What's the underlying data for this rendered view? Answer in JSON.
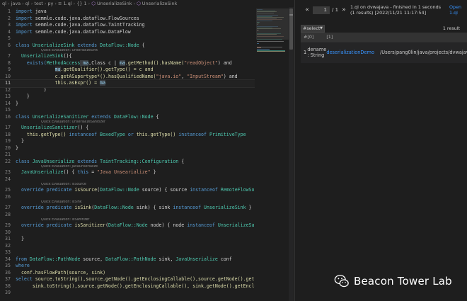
{
  "breadcrumb": {
    "items": [
      "ql",
      "java",
      "ql",
      "test",
      "py",
      "1.ql",
      "1",
      "UnserializeSink",
      "UnserializeSink"
    ],
    "icons": [
      "folder",
      "folder",
      "folder",
      "folder",
      "folder",
      "ql-file-icon",
      "braces-icon",
      "class-icon",
      "class-icon"
    ]
  },
  "code": {
    "l1": {
      "num": "1",
      "a": "import ",
      "b": "java"
    },
    "l2": {
      "num": "2",
      "a": "import ",
      "b": "semmle.code.java.dataflow.FlowSources"
    },
    "l3": {
      "num": "3",
      "a": "import ",
      "b": "semmle.code.java.dataflow.TaintTracking"
    },
    "l4": {
      "num": "4",
      "a": "import ",
      "b": "semmle.code.java.dataflow.DataFlow"
    },
    "l5": {
      "num": "5"
    },
    "l6": {
      "num": "6",
      "a": "class ",
      "b": "UnserializeSink",
      "c": " extends ",
      "d": "DataFlow::Node",
      "e": " {"
    },
    "h6": "Quick Evaluation: UnserializeSink",
    "l7": {
      "num": "7",
      "a": "UnserializeSink",
      "b": "(){"
    },
    "l8": {
      "num": "8",
      "a": "exists(",
      "b": "MethodAccess",
      "c": " ma",
      "d": ",Class c | ",
      "e": "ma",
      "f": ".getMethod().hasName(",
      "g": "\"readObject\"",
      "h": ") and"
    },
    "l9": {
      "num": "9",
      "a": "ma",
      "b": ".getQualifier().getType() = c and"
    },
    "l10": {
      "num": "10",
      "a": "c.getASupertype*().hasQualifiedName(",
      "b": "\"java.io\"",
      "c": ", ",
      "d": "\"InputStream\"",
      "e": ") and"
    },
    "l11": {
      "num": "11",
      "a": "this.asExpr() = ",
      "b": "ma"
    },
    "l12": {
      "num": "12",
      "a": ")"
    },
    "l13": {
      "num": "13",
      "a": "}"
    },
    "l14": {
      "num": "14",
      "a": "}"
    },
    "l15": {
      "num": "15"
    },
    "l16": {
      "num": "16",
      "a": "class ",
      "b": "UnserializeSanitizer",
      "c": " extends ",
      "d": "DataFlow::Node",
      "e": " {"
    },
    "h16": "Quick Evaluation: UnserializeSanitizer",
    "l17": {
      "num": "17",
      "a": "UnserializeSanitizer",
      "b": "() {"
    },
    "l18": {
      "num": "18",
      "a": "this.getType() ",
      "b": "instanceof ",
      "c": "BoxedType",
      "d": " or ",
      "e": "this.getType() ",
      "f": "instanceof ",
      "g": "PrimitiveType"
    },
    "l19": {
      "num": "19",
      "a": "}"
    },
    "l20": {
      "num": "20",
      "a": "}"
    },
    "l21": {
      "num": "21"
    },
    "l22": {
      "num": "22",
      "a": "class ",
      "b": "JavaUnserialize",
      "c": " extends ",
      "d": "TaintTracking::Configuration",
      "e": " {"
    },
    "h22": "Quick Evaluation: JavaUnserialize",
    "l23": {
      "num": "23",
      "a": "JavaUnserialize",
      "b": "() { ",
      "c": "this",
      "d": " = ",
      "e": "\"Java Unsearialize\"",
      "f": " }"
    },
    "l24": {
      "num": "24"
    },
    "h24": "Quick Evaluation: isSource",
    "l25": {
      "num": "25",
      "a": "override predicate ",
      "b": "isSource",
      "c": "(",
      "d": "DataFlow::Node",
      "e": " source) { source ",
      "f": "instanceof ",
      "g": "RemoteFlowSource"
    },
    "l26": {
      "num": "26"
    },
    "h26": "Quick Evaluation: isSink",
    "l27": {
      "num": "27",
      "a": "override predicate ",
      "b": "isSink",
      "c": "(",
      "d": "DataFlow::Node",
      "e": " sink) { sink ",
      "f": "instanceof ",
      "g": "UnserializeSink",
      "h": " }"
    },
    "l28": {
      "num": "28"
    },
    "h28": "Quick Evaluation: isSanitizer",
    "l29": {
      "num": "29",
      "a": "override predicate ",
      "b": "isSanitizer",
      "c": "(",
      "d": "DataFlow::Node",
      "e": " node) { node ",
      "f": "instanceof ",
      "g": "UnserializeSaniti"
    },
    "l30": {
      "num": "30"
    },
    "l31": {
      "num": "31",
      "a": "}"
    },
    "l32": {
      "num": "32"
    },
    "l33": {
      "num": "33"
    },
    "l34": {
      "num": "34",
      "a": "from ",
      "b": "DataFlow::PathNode",
      "c": " source, ",
      "d": "DataFlow::PathNode",
      "e": " sink, ",
      "f": "JavaUnserialize",
      "g": " conf"
    },
    "l35": {
      "num": "35",
      "a": "where"
    },
    "l36": {
      "num": "36",
      "a": "conf.hasFlowPath(source, sink)"
    },
    "l37": {
      "num": "37",
      "a": "select ",
      "b": "source.toString(),source.getNode().getEnclosingCallable(),source.getNode().getEnclos"
    },
    "l38": {
      "num": "38",
      "a": "sink.toString(),source.getNode().getEnclosingCallable(), sink.getNode().getEnclosingC"
    },
    "l39": {
      "num": "39"
    }
  },
  "results": {
    "page_current": "1",
    "page_total": "/ 1",
    "run_info": "1.ql on dvwajava - finished in 1 seconds (1 results) [2022/11/21 11:17:54]",
    "open_link": "Open 1.ql",
    "select_label": "#select",
    "result_count": "1 result",
    "columns": [
      "#",
      "[0]",
      "[1]"
    ],
    "rows": [
      {
        "num": "1",
        "entity": "dename : String",
        "link": "deserializationDemo",
        "path": "/Users/pang0lin/java/projects/dvwajava/s"
      }
    ]
  },
  "watermark": {
    "text": "Beacon Tower Lab"
  },
  "colors": {
    "keyword": "#569cd6",
    "type": "#4ec9b0",
    "function": "#dcdcaa",
    "string": "#ce9178",
    "link": "#3794ff",
    "background": "#1e1e1e"
  }
}
